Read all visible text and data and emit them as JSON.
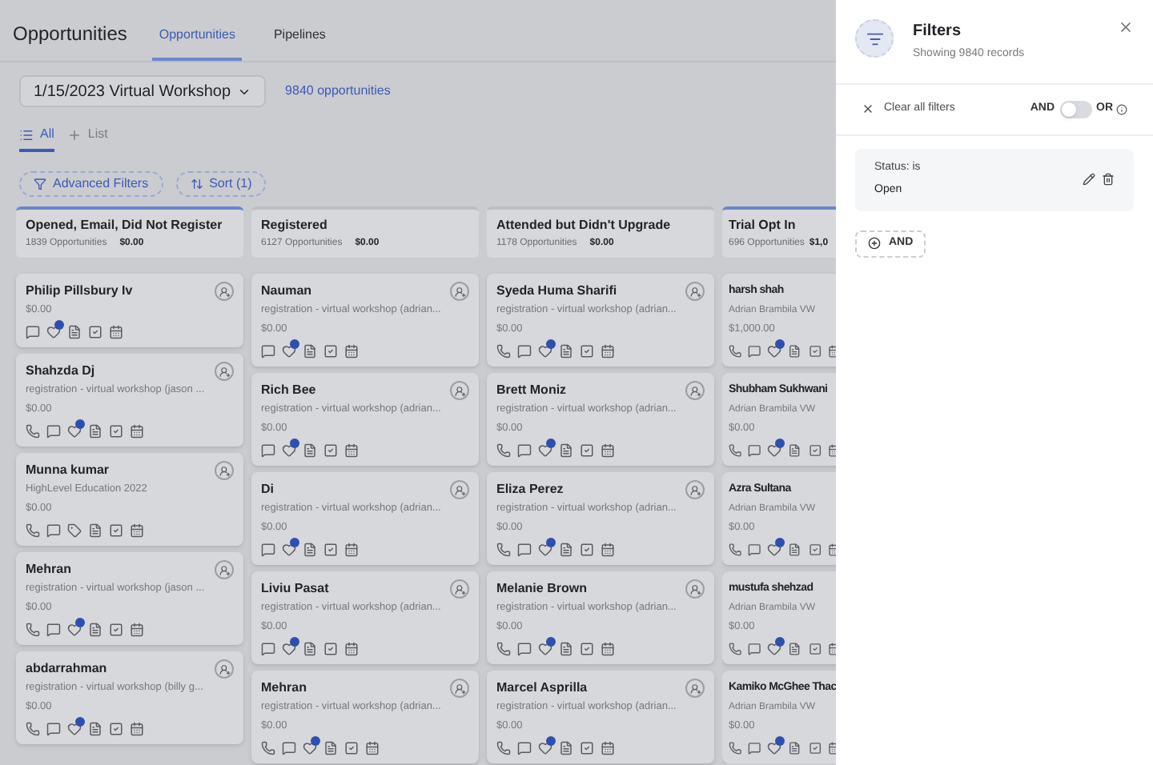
{
  "header": {
    "title": "Opportunities",
    "tabs": [
      {
        "label": "Opportunities",
        "selected": true
      },
      {
        "label": "Pipelines",
        "selected": false
      }
    ]
  },
  "pipeline_select": {
    "value": "1/15/2023 Virtual Workshop"
  },
  "count_link": "9840 opportunities",
  "view_tabs": [
    {
      "label": "All",
      "kind": "list",
      "selected": true
    },
    {
      "label": "List",
      "kind": "add",
      "selected": false
    }
  ],
  "toolbar": [
    {
      "label": "Advanced Filters",
      "kind": "filter"
    },
    {
      "label": "Sort (1)",
      "kind": "sort"
    }
  ],
  "columns": [
    {
      "title": "Opened, Email, Did Not Register",
      "count": "1839 Opportunities",
      "total": "$0.00",
      "accent": true,
      "assign": true,
      "cards": [
        {
          "name": "Philip Pillsbury Iv",
          "amount": "$0.00",
          "phone": false,
          "badge": true,
          "tag": false
        },
        {
          "name": "Shahzda Dj",
          "subtitle": "registration - virtual workshop (jason ...",
          "amount": "$0.00",
          "phone": true,
          "badge": true,
          "tag": false
        },
        {
          "name": "Munna kumar",
          "subtitle": "HighLevel Education 2022",
          "amount": "$0.00",
          "phone": true,
          "badge": false,
          "tag": true
        },
        {
          "name": "Mehran",
          "subtitle": "registration - virtual workshop (jason ...",
          "amount": "$0.00",
          "phone": true,
          "badge": true,
          "tag": false
        },
        {
          "name": "abdarrahman",
          "subtitle": "registration - virtual workshop (billy g...",
          "amount": "$0.00",
          "phone": true,
          "badge": true,
          "tag": false
        }
      ]
    },
    {
      "title": "Registered",
      "count": "6127 Opportunities",
      "total": "$0.00",
      "accent": false,
      "assign": true,
      "cards": [
        {
          "name": "Nauman",
          "subtitle": "registration - virtual workshop (adrian...",
          "amount": "$0.00",
          "phone": false,
          "badge": true,
          "tag": false
        },
        {
          "name": "Rich Bee",
          "subtitle": "registration - virtual workshop (adrian...",
          "amount": "$0.00",
          "phone": false,
          "badge": true,
          "tag": false
        },
        {
          "name": "Di",
          "subtitle": "registration - virtual workshop (adrian...",
          "amount": "$0.00",
          "phone": false,
          "badge": true,
          "tag": false
        },
        {
          "name": "Liviu Pasat",
          "subtitle": "registration - virtual workshop (adrian...",
          "amount": "$0.00",
          "phone": false,
          "badge": true,
          "tag": false
        },
        {
          "name": "Mehran",
          "subtitle": "registration - virtual workshop (adrian...",
          "amount": "$0.00",
          "phone": true,
          "badge": true,
          "tag": false
        }
      ]
    },
    {
      "title": "Attended but Didn't Upgrade",
      "count": "1178 Opportunities",
      "total": "$0.00",
      "accent": false,
      "assign": true,
      "cards": [
        {
          "name": "Syeda Huma Sharifi",
          "subtitle": "registration - virtual workshop (adrian...",
          "amount": "$0.00",
          "phone": true,
          "badge": true,
          "tag": false
        },
        {
          "name": "Brett Moniz",
          "subtitle": "registration - virtual workshop (adrian...",
          "amount": "$0.00",
          "phone": true,
          "badge": true,
          "tag": false
        },
        {
          "name": "Eliza Perez",
          "subtitle": "registration - virtual workshop (adrian...",
          "amount": "$0.00",
          "phone": true,
          "badge": true,
          "tag": false
        },
        {
          "name": "Melanie Brown",
          "subtitle": "registration - virtual workshop (adrian...",
          "amount": "$0.00",
          "phone": true,
          "badge": true,
          "tag": false
        },
        {
          "name": "Marcel Asprilla",
          "subtitle": "registration - virtual workshop (adrian...",
          "amount": "$0.00",
          "phone": true,
          "badge": true,
          "tag": false
        }
      ]
    },
    {
      "title": "Trial Opt In",
      "count": "696 Opportunities",
      "total": "$1,0",
      "accent": true,
      "assign": false,
      "cards": [
        {
          "name": "harsh shah",
          "subtitle": "Adrian Brambila VW",
          "amount": "$1,000.00",
          "phone": true,
          "badge": true,
          "tag": false
        },
        {
          "name": "Shubham Sukhwani",
          "subtitle": "Adrian Brambila VW",
          "amount": "$0.00",
          "phone": true,
          "badge": true,
          "tag": false
        },
        {
          "name": "Azra Sultana",
          "subtitle": "Adrian Brambila VW",
          "amount": "$0.00",
          "phone": true,
          "badge": true,
          "tag": false
        },
        {
          "name": "mustufa shehzad",
          "subtitle": "Adrian Brambila VW",
          "amount": "$0.00",
          "phone": true,
          "badge": true,
          "tag": false
        },
        {
          "name": "Kamiko McGhee Thac",
          "subtitle": "Adrian Brambila VW",
          "amount": "$0.00",
          "phone": true,
          "badge": true,
          "tag": false
        }
      ]
    }
  ],
  "filters_panel": {
    "title": "Filters",
    "subtitle": "Showing 9840 records",
    "clear_label": "Clear all filters",
    "and_label": "AND",
    "or_label": "OR",
    "toggle_on": false,
    "filters": [
      {
        "label": "Status: is",
        "value": "Open"
      }
    ],
    "add_button": "AND"
  }
}
